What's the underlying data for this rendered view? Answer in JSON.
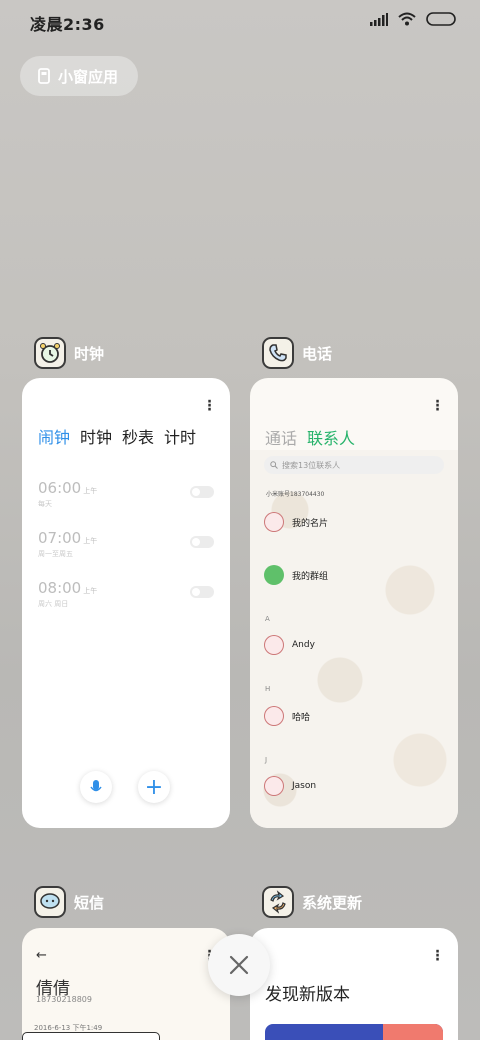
{
  "status": {
    "time": "凌晨2:36"
  },
  "small_window": {
    "label": "小窗应用"
  },
  "apps": {
    "clock": {
      "title": "时钟",
      "tabs": [
        "闹钟",
        "时钟",
        "秒表",
        "计时"
      ],
      "alarms": [
        {
          "time": "06:00",
          "ampm": "上午",
          "repeat": "每天"
        },
        {
          "time": "07:00",
          "ampm": "上午",
          "repeat": "周一至周五"
        },
        {
          "time": "08:00",
          "ampm": "上午",
          "repeat": "周六 周日"
        }
      ]
    },
    "phone": {
      "title": "电话",
      "tabs": [
        "通话",
        "联系人"
      ],
      "search_placeholder": "搜索13位联系人",
      "account": "小米账号183704430",
      "contacts": [
        "我的名片",
        "我的群组",
        "Andy",
        "哈哈",
        "Jason"
      ],
      "sections": [
        "A",
        "H",
        "J"
      ]
    },
    "sms": {
      "title": "短信",
      "contact_name": "倩倩",
      "contact_number": "18730218809",
      "timestamp": "2016-6-13 下午1:49"
    },
    "update": {
      "title": "系统更新",
      "headline": "发现新版本"
    }
  },
  "colors": {
    "accent_blue": "#2f8fe8",
    "accent_green": "#27b36b"
  }
}
